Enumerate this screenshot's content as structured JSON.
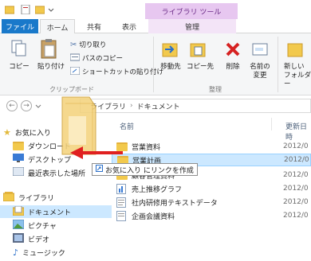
{
  "titlebar": {
    "contextual_tab": "ライブラリ ツール"
  },
  "tabs": {
    "file": "ファイル",
    "home": "ホーム",
    "share": "共有",
    "view": "表示",
    "manage": "管理"
  },
  "ribbon": {
    "copy": "コピー",
    "paste": "貼り付け",
    "cut": "切り取り",
    "copy_path": "パスのコピー",
    "paste_shortcut": "ショートカットの貼り付け",
    "group_clipboard": "クリップボード",
    "move_to": "移動先",
    "copy_to": "コピー先",
    "delete": "削除",
    "rename_line1": "名前の",
    "rename_line2": "変更",
    "new_folder_line1": "新しい",
    "new_folder_line2": "フォルダー",
    "group_organize": "整理"
  },
  "address": {
    "crumb1": "ライブラリ",
    "crumb2": "ドキュメント"
  },
  "nav": {
    "favorites": "お気に入り",
    "downloads": "ダウンロード",
    "desktop": "デスクトップ",
    "recent": "最近表示した場所",
    "libraries": "ライブラリ",
    "documents": "ドキュメント",
    "pictures": "ピクチャ",
    "videos": "ビデオ",
    "music": "ミュージック"
  },
  "columns": {
    "name": "名前",
    "date": "更新日時"
  },
  "files": [
    {
      "name": "営業資料",
      "date": "2012/0"
    },
    {
      "name": "営業計画",
      "date": "2012/0"
    },
    {
      "name": "顧客管理資料",
      "date": "2012/0"
    },
    {
      "name": "売上推移グラフ",
      "date": "2012/0"
    },
    {
      "name": "社内研修用テキストデータ",
      "date": "2012/0"
    },
    {
      "name": "企画会議資料",
      "date": "2012/0"
    }
  ],
  "drag": {
    "tooltip": "お気に入り にリンクを作成"
  },
  "colors": {
    "accent": "#1979ca",
    "contextual": "#e7c7f0",
    "selection": "#cce8ff",
    "arrow": "#e02020"
  }
}
